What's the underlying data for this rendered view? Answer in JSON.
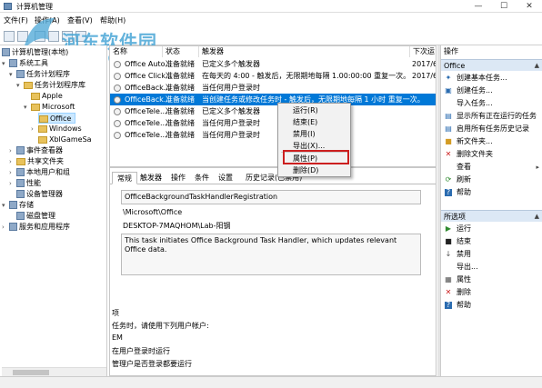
{
  "window": {
    "title": "计算机管理"
  },
  "menu": [
    "文件(F)",
    "操作(A)",
    "查看(V)",
    "帮助(H)"
  ],
  "watermark": {
    "text": "河东软件园",
    "url": "www.pc0359.cn"
  },
  "tree": {
    "root": "计算机管理(本地)",
    "items": [
      "系统工具",
      "任务计划程序",
      "任务计划程序库",
      "Apple",
      "Microsoft",
      "Office",
      "Windows",
      "XblGameSa",
      "事件查看器",
      "共享文件夹",
      "本地用户和组",
      "性能",
      "设备管理器",
      "存储",
      "磁盘管理",
      "服务和应用程序"
    ]
  },
  "tasklist": {
    "headers": [
      "名称",
      "状态",
      "触发器",
      "下次运"
    ],
    "rows": [
      {
        "name": "Office Auto...",
        "status": "准备就绪",
        "trigger": "已定义多个触发器",
        "next": "2017/6"
      },
      {
        "name": "Office Click...",
        "status": "准备就绪",
        "trigger": "在每天的 4:00 - 触发后，无限期地每隔 1.00:00:00 重复一次。",
        "next": "2017/6"
      },
      {
        "name": "OfficeBack...",
        "status": "准备就绪",
        "trigger": "当任何用户登录时",
        "next": ""
      },
      {
        "name": "OfficeBack...",
        "status": "准备就绪",
        "trigger": "当创建任务或修改任务时 - 触发后，无限期地每隔 1 小时 重复一次。",
        "next": ""
      },
      {
        "name": "OfficeTele...",
        "status": "准备就绪",
        "trigger": "已定义多个触发器",
        "next": ""
      },
      {
        "name": "OfficeTele...",
        "status": "准备就绪",
        "trigger": "当任何用户登录时",
        "next": ""
      },
      {
        "name": "OfficeTele...",
        "status": "准备就绪",
        "trigger": "当任何用户登录时",
        "next": ""
      }
    ]
  },
  "context_menu": [
    "运行(R)",
    "结束(E)",
    "禁用(I)",
    "导出(X)...",
    "属性(P)",
    "删除(D)"
  ],
  "detail": {
    "tabs": [
      "常规",
      "触发器",
      "操作",
      "条件",
      "设置",
      "历史记录(已禁用)"
    ],
    "name_value": "OfficeBackgroundTaskHandlerRegistration",
    "location_value": "\\Microsoft\\Office",
    "author_value": "DESKTOP-7MAQHOM\\Lab-阳钢",
    "description_value": "This task initiates Office Background Task Handler, which updates relevant Office data.",
    "label_option": "项",
    "label_run_as": "任务时，请使用下列用户帐户:",
    "label_user": "EM",
    "label_logged": "在用户登录时运行",
    "label_partial": "管理户是否登录都要运行"
  },
  "actions": {
    "header": "操作",
    "section1": "Office",
    "items1": [
      "创建基本任务...",
      "创建任务...",
      "导入任务...",
      "显示所有正在运行的任务",
      "启用所有任务历史记录",
      "新文件夹...",
      "删除文件夹",
      "查看",
      "刷新",
      "帮助"
    ],
    "section2": "所选项",
    "items2": [
      "运行",
      "结束",
      "禁用",
      "导出...",
      "属性",
      "删除",
      "帮助"
    ]
  },
  "colors": {
    "selection": "#0078d7",
    "highlight_box": "#cc1f1f",
    "section_bg": "#dce8f5"
  }
}
